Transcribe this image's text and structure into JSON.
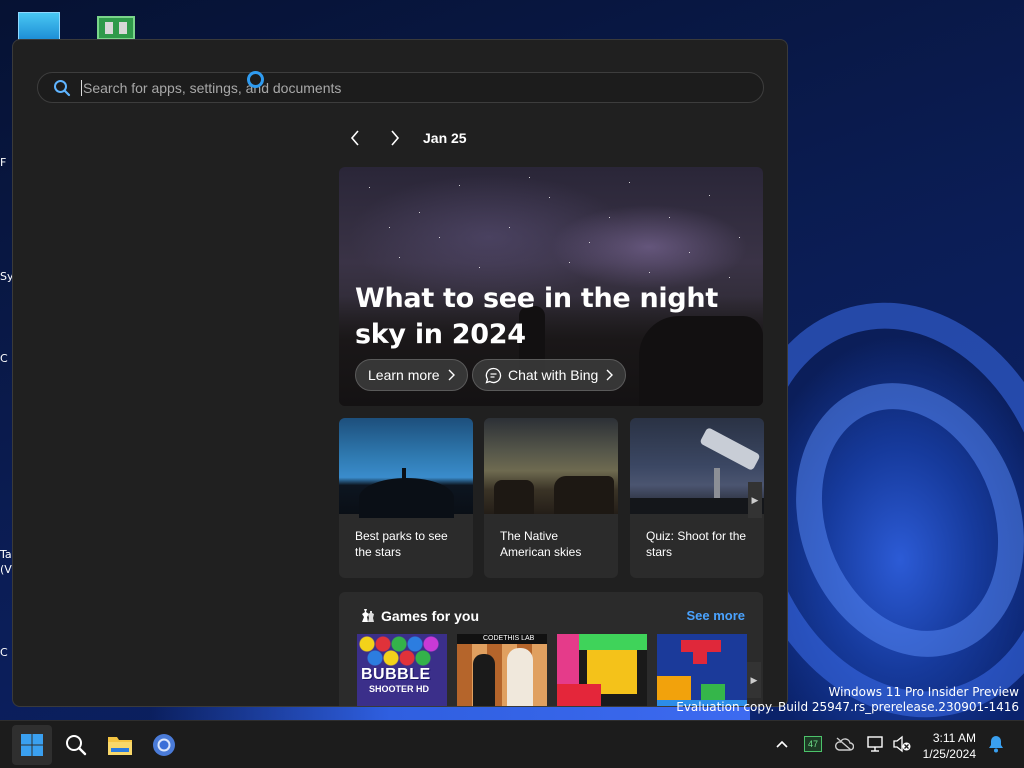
{
  "search": {
    "placeholder": "Search for apps, settings, and documents"
  },
  "widgets": {
    "date": "Jan 25",
    "hero": {
      "title": "What to see in the night sky in 2024",
      "learn_more": "Learn more",
      "chat_bing": "Chat with Bing"
    },
    "cards": [
      {
        "label": "Best parks to see the stars"
      },
      {
        "label": "The Native American skies"
      },
      {
        "label": "Quiz: Shoot for the stars"
      }
    ],
    "games": {
      "title": "Games for you",
      "see_more": "See more",
      "items": [
        {
          "name": "BUBBLE",
          "subtitle": "SHOOTER HD"
        },
        {
          "name": "CODETHIS LAB"
        },
        {
          "name": ""
        },
        {
          "name": ""
        }
      ]
    }
  },
  "desktop": {
    "left_edge_fragments": [
      "F",
      "Sy",
      "C",
      "Ta",
      "(V",
      "C"
    ]
  },
  "watermark": {
    "line1": "Windows 11 Pro Insider Preview",
    "line2": "Evaluation copy. Build 25947.rs_prerelease.230901-1416"
  },
  "taskbar": {
    "apps": [
      "start",
      "search",
      "file-explorer",
      "chrome"
    ],
    "tray": {
      "badge": "47",
      "time": "3:11 AM",
      "date": "1/25/2024"
    }
  },
  "colors": {
    "accent": "#4aa3ff",
    "menu_bg": "#202020",
    "card_bg": "#2b2b2b",
    "cursor": "#2f9bf0"
  }
}
